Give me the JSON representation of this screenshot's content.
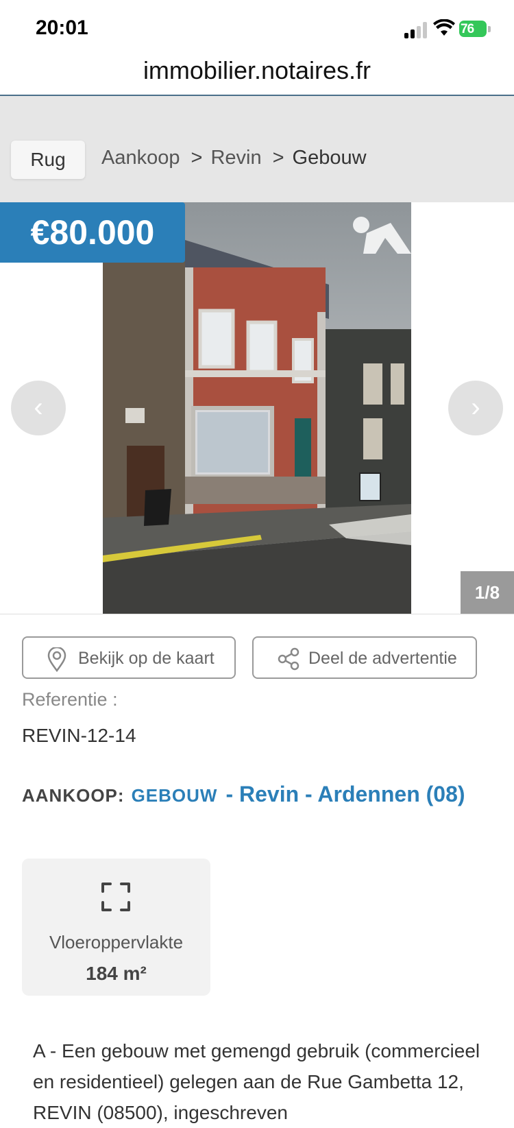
{
  "status": {
    "time": "20:01",
    "battery": "76"
  },
  "browser": {
    "url": "immobilier.notaires.fr"
  },
  "nav": {
    "back_label": "Rug",
    "breadcrumbs": [
      "Aankoop",
      "Revin",
      "Gebouw"
    ],
    "separator": ">"
  },
  "gallery": {
    "price": "€80.000",
    "counter": "1/8",
    "prev_glyph": "‹",
    "next_glyph": "›"
  },
  "actions": {
    "map_label": "Bekijk op de kaart",
    "share_label": "Deel de advertentie"
  },
  "reference": {
    "label": "Referentie :",
    "value": "REVIN-12-14"
  },
  "listing": {
    "kind": "AANKOOP:",
    "type": "GEBOUW",
    "location": "- Revin - Ardennen (08)"
  },
  "feature": {
    "icon": "expand-icon",
    "label": "Vloeroppervlakte",
    "value": "184 m²"
  },
  "description": "A - Een gebouw met gemengd gebruik (commercieel en residentieel) gelegen aan de Rue Gambetta 12, REVIN (08500), ingeschreven",
  "colors": {
    "accent": "#2b7fb8",
    "battery": "#34c759"
  }
}
